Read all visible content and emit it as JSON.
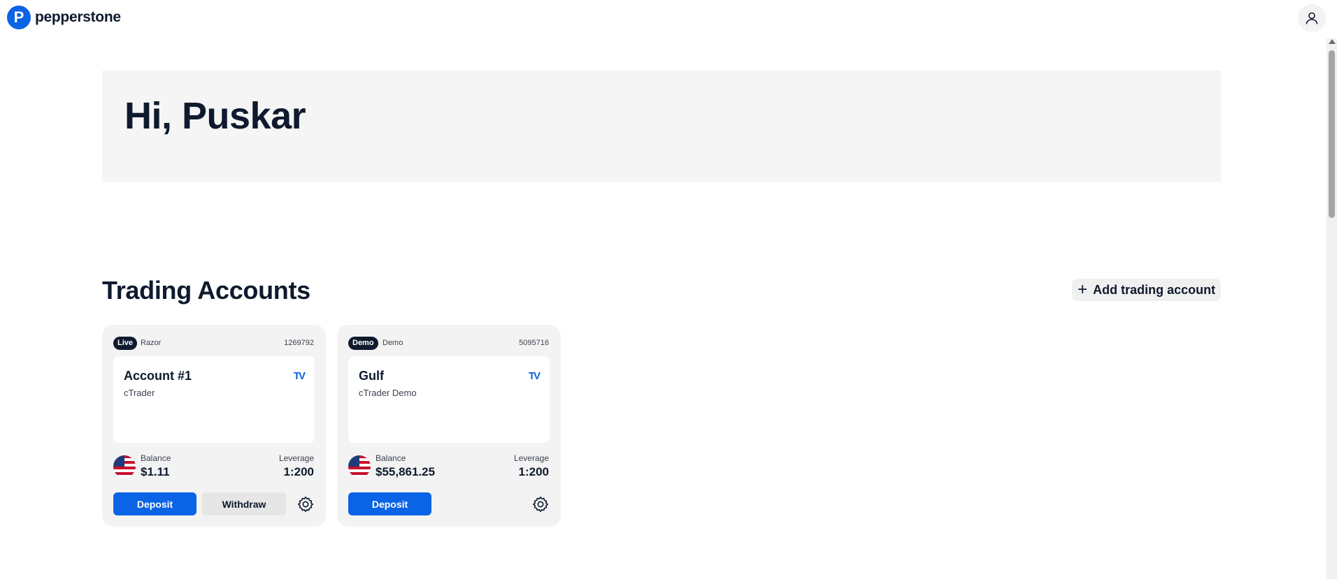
{
  "brand": {
    "name": "pepperstone",
    "logo_letter": "P",
    "accent": "#0b63e5"
  },
  "hero": {
    "greeting": "Hi, Puskar"
  },
  "accounts_section": {
    "title": "Trading Accounts",
    "add_button_label": "Add trading account",
    "add_button_icon": "+"
  },
  "accounts": [
    {
      "badge": "Live",
      "type": "Razor",
      "number": "1269792",
      "name": "Account #1",
      "platform": "cTrader",
      "platform_icon": "TV",
      "balance_label": "Balance",
      "balance": "$1.11",
      "leverage_label": "Leverage",
      "leverage": "1:200",
      "deposit_label": "Deposit",
      "withdraw_label": "Withdraw"
    },
    {
      "badge": "Demo",
      "type": "Demo",
      "number": "5095716",
      "name": "Gulf",
      "platform": "cTrader Demo",
      "platform_icon": "TV",
      "balance_label": "Balance",
      "balance": "$55,861.25",
      "leverage_label": "Leverage",
      "leverage": "1:200",
      "deposit_label": "Deposit"
    }
  ]
}
